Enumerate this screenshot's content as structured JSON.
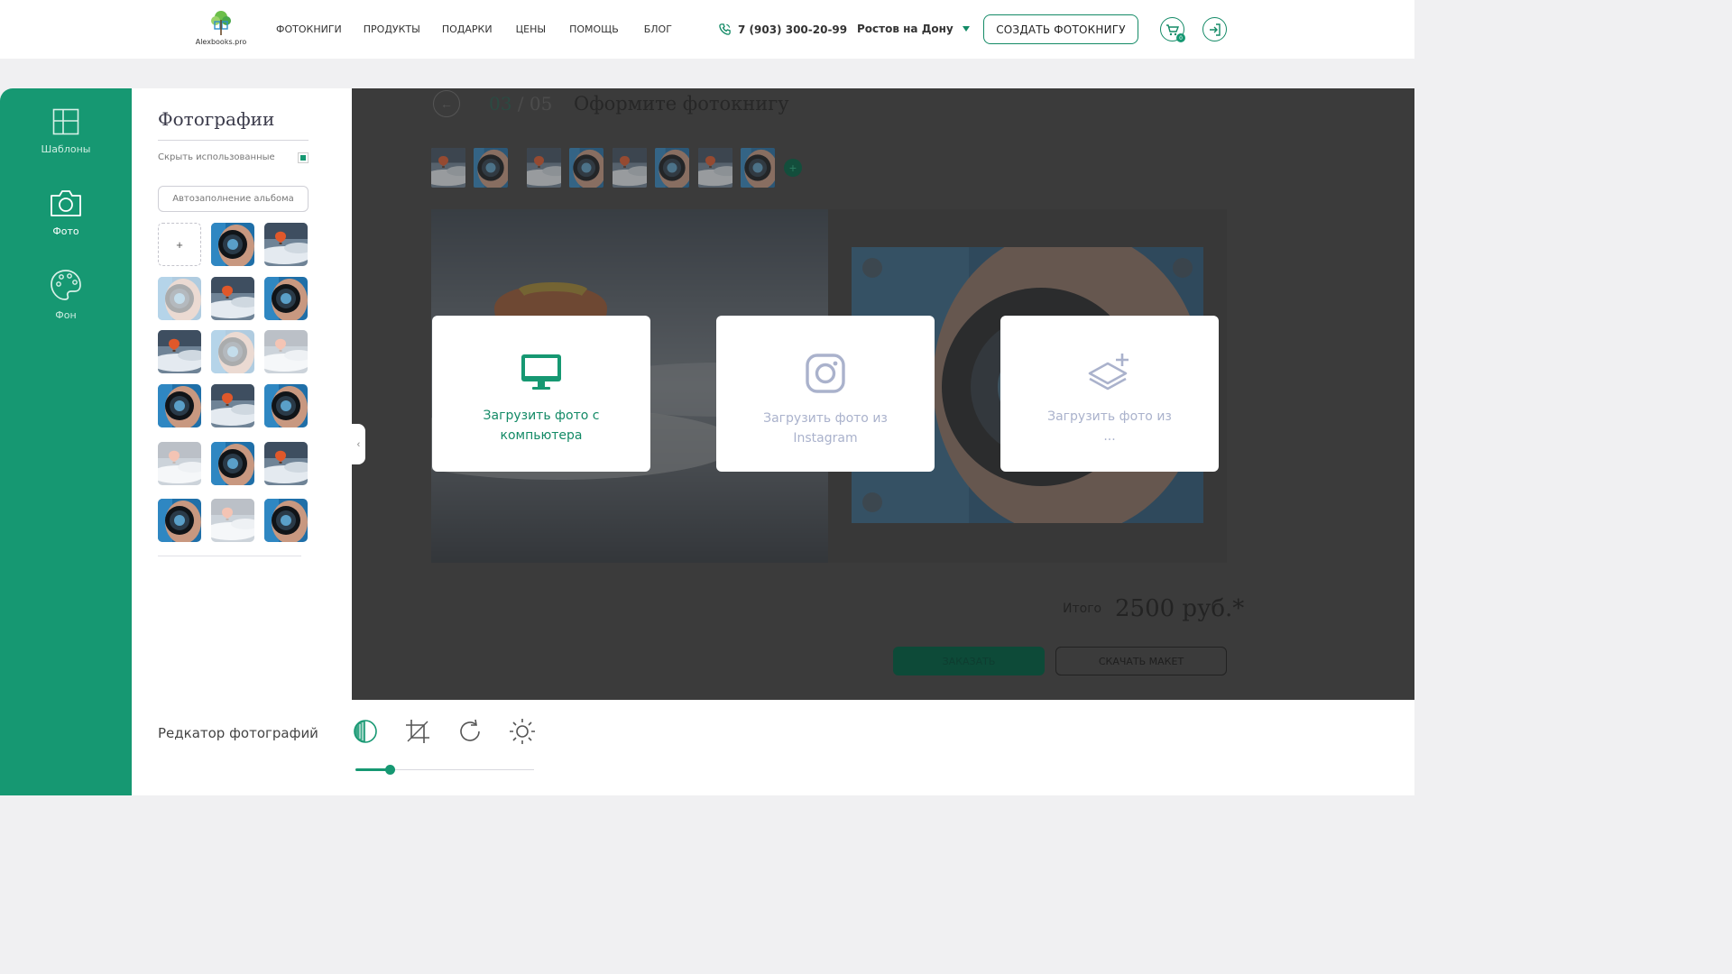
{
  "header": {
    "logo_text": "Alexbooks.pro",
    "nav": [
      "ФОТОКНИГИ",
      "ПРОДУКТЫ",
      "ПОДАРКИ",
      "ЦЕНЫ",
      "ПОМОЩЬ",
      "БЛОГ"
    ],
    "phone": "7 (903) 300-20-99",
    "city": "Ростов на Дону",
    "create_button": "СОЗДАТЬ ФОТОКНИГУ",
    "cart_count": "0"
  },
  "rail": {
    "items": [
      {
        "label": "Шаблоны",
        "icon": "templates-icon"
      },
      {
        "label": "Фото",
        "icon": "camera-icon"
      },
      {
        "label": "Фон",
        "icon": "palette-icon"
      }
    ]
  },
  "photos_panel": {
    "title": "Фотографии",
    "hide_used_label": "Скрыть использованные",
    "hide_used_checked": true,
    "autofill_button": "Автозаполнение альбома",
    "add_tile": "+",
    "tiles": [
      "lens",
      "balloon",
      "lens-faded",
      "balloon",
      "lens",
      "balloon",
      "lens-faded",
      "balloon-faded",
      "lens",
      "balloon",
      "lens",
      "balloon-faded",
      "lens",
      "balloon",
      "lens",
      "balloon-faded",
      "lens"
    ]
  },
  "workspace": {
    "back_icon": "arrow-left-icon",
    "step_current": "03",
    "step_separator": " / ",
    "step_total": "05",
    "title": "Оформите фотокнигу",
    "thumbs": [
      "balloon",
      "lens",
      "balloon",
      "lens",
      "balloon",
      "lens",
      "balloon",
      "lens"
    ],
    "add_thumb": "+",
    "total_label": "Итого",
    "total_value": "2500 руб.*",
    "order_button": "ЗАКАЗАТЬ",
    "download_button": "СКАЧАТЬ МАКЕТ"
  },
  "upload_cards": [
    {
      "label_line1": "Загрузить фото с",
      "label_line2": "компьютера",
      "icon": "monitor-icon"
    },
    {
      "label_line1": "Загрузить фото из",
      "label_line2": "Instagram",
      "icon": "instagram-icon"
    },
    {
      "label_line1": "Загрузить фото из",
      "label_line2": "...",
      "icon": "layers-add-icon"
    }
  ],
  "editor": {
    "title": "Редкатор фотографий",
    "tools": [
      "contrast-icon",
      "crop-icon",
      "rotate-icon",
      "brightness-icon"
    ],
    "slider_value": 0.19
  },
  "colors": {
    "accent": "#169872",
    "accent_dark": "#138a66",
    "overlay": "#3b3b3b",
    "muted_text": "#aab2cc"
  }
}
